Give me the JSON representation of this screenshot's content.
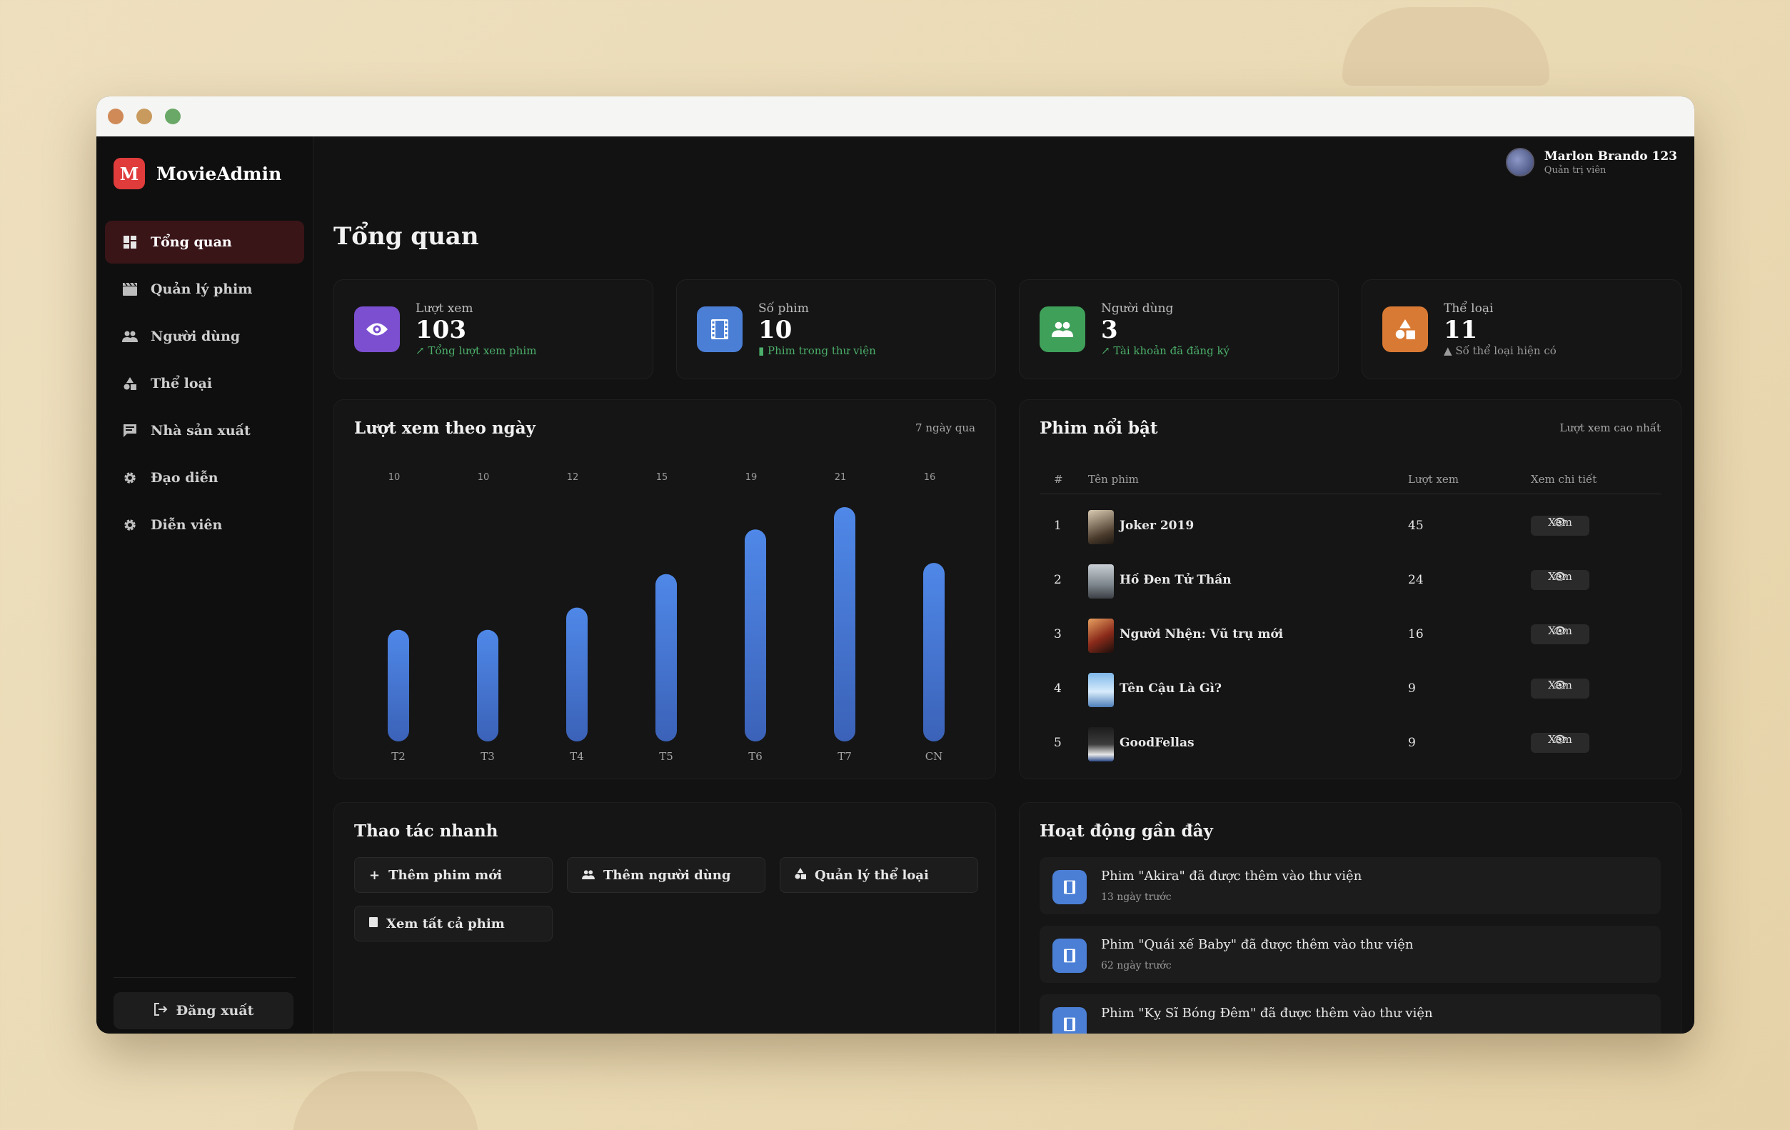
{
  "app": {
    "name": "MovieAdmin",
    "logo_letter": "M"
  },
  "sidebar": {
    "items": [
      {
        "label": "Tổng quan",
        "icon": "dashboard-icon",
        "active": true
      },
      {
        "label": "Quản lý phim",
        "icon": "clapper-icon"
      },
      {
        "label": "Người dùng",
        "icon": "users-icon"
      },
      {
        "label": "Thể loại",
        "icon": "shapes-icon"
      },
      {
        "label": "Nhà sản xuất",
        "icon": "message-icon"
      },
      {
        "label": "Đạo diễn",
        "icon": "gear-icon"
      },
      {
        "label": "Diễn viên",
        "icon": "gear-icon"
      }
    ],
    "logout_label": "Đăng xuất"
  },
  "user": {
    "name": "Marlon Brando 123",
    "role": "Quản trị viên"
  },
  "page_title": "Tổng quan",
  "stats": [
    {
      "label": "Lượt xem",
      "value": "103",
      "sub": "Tổng lượt xem phim",
      "color": "#7b4fd0",
      "icon": "eye-icon"
    },
    {
      "label": "Số phim",
      "value": "10",
      "sub": "Phim trong thư viện",
      "color": "#4b7fd6",
      "icon": "film-icon"
    },
    {
      "label": "Người dùng",
      "value": "3",
      "sub": "Tài khoản đã đăng ký",
      "color": "#3fa05a",
      "icon": "users-icon"
    },
    {
      "label": "Thể loại",
      "value": "11",
      "sub": "Số thể loại hiện có",
      "color": "#d97a34",
      "icon": "shapes-icon"
    }
  ],
  "views_chart": {
    "title": "Lượt xem theo ngày",
    "meta": "7 ngày qua"
  },
  "chart_data": {
    "type": "bar",
    "categories": [
      "T2",
      "T3",
      "T4",
      "T5",
      "T6",
      "T7",
      "CN"
    ],
    "values": [
      10,
      10,
      12,
      15,
      19,
      21,
      16
    ],
    "ylim": [
      0,
      21
    ],
    "color": "#4a7fd9",
    "grid": false
  },
  "featured": {
    "title": "Phim nổi bật",
    "meta": "Lượt xem cao nhất",
    "headers": {
      "rank": "#",
      "name": "Tên phim",
      "views": "Lượt xem",
      "detail": "Xem chi tiết"
    },
    "view_label": "Xem",
    "rows": [
      {
        "rank": "1",
        "name": "Joker 2019",
        "views": "45"
      },
      {
        "rank": "2",
        "name": "Hố Đen Tử Thần",
        "views": "24"
      },
      {
        "rank": "3",
        "name": "Người Nhện: Vũ trụ mới",
        "views": "16"
      },
      {
        "rank": "4",
        "name": "Tên Cậu Là Gì?",
        "views": "9"
      },
      {
        "rank": "5",
        "name": "GoodFellas",
        "views": "9"
      }
    ]
  },
  "quick_actions": {
    "title": "Thao tác nhanh",
    "buttons": [
      {
        "label": "Thêm phim mới",
        "icon": "plus-icon"
      },
      {
        "label": "Thêm người dùng",
        "icon": "users-icon"
      },
      {
        "label": "Quản lý thể loại",
        "icon": "shapes-icon"
      },
      {
        "label": "Xem tất cả phim",
        "icon": "film-icon"
      }
    ]
  },
  "activity": {
    "title": "Hoạt động gần đây",
    "items": [
      {
        "text": "Phim \"Akira\" đã được thêm vào thư viện",
        "time": "13 ngày trước"
      },
      {
        "text": "Phim \"Quái xế Baby\" đã được thêm vào thư viện",
        "time": "62 ngày trước"
      },
      {
        "text": "Phim \"Kỵ Sĩ Bóng Đêm\" đã được thêm vào thư viện",
        "time": ""
      }
    ]
  }
}
